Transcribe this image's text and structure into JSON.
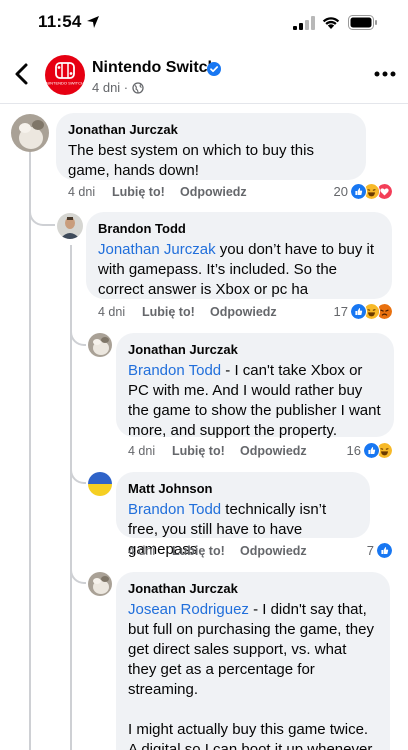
{
  "status_bar": {
    "time": "11:54"
  },
  "header": {
    "page_name": "Nintendo Switch",
    "time_ago": "4 dni ·",
    "logo_text": "NINTENDO SWITCH"
  },
  "comments": [
    {
      "author": "Jonathan Jurczak",
      "mention": "",
      "text": "The best system on which to buy this game, hands down!",
      "time": "4 dni",
      "like": "Lubię to!",
      "reply": "Odpowiedz",
      "reaction_count": "20",
      "reactions": [
        "like-icon",
        "haha-icon",
        "love-icon"
      ]
    },
    {
      "author": "Brandon Todd",
      "mention": "Jonathan Jurczak",
      "text": " you don’t have to buy it with gamepass. It’s included. So the correct answer is Xbox or pc ha",
      "time": "4 dni",
      "like": "Lubię to!",
      "reply": "Odpowiedz",
      "reaction_count": "17",
      "reactions": [
        "like-icon",
        "haha-icon",
        "angry-icon"
      ]
    },
    {
      "author": "Jonathan Jurczak",
      "mention": "Brandon Todd",
      "text": " - I can't take Xbox or PC with me. And I would rather buy the game to show the publisher I want more, and support the property.",
      "time": "4 dni",
      "like": "Lubię to!",
      "reply": "Odpowiedz",
      "reaction_count": "16",
      "reactions": [
        "like-icon",
        "haha-icon"
      ]
    },
    {
      "author": "Matt Johnson",
      "mention": "Brandon Todd",
      "text": " technically isn’t free, you still have to have gamepass",
      "time": "4 dni",
      "like": "Lubię to!",
      "reply": "Odpowiedz",
      "reaction_count": "7",
      "reactions": [
        "like-icon"
      ]
    },
    {
      "author": "Jonathan Jurczak",
      "mention": "Josean Rodriguez",
      "text": " - I didn't say that, but full on purchasing the game, they get direct sales support, vs. what they get as a percentage for streaming.",
      "text2": "I might actually buy this game twice. A digital so I can boot it up whenever, and a physical to collect. 😍"
    }
  ],
  "colors": {
    "mention": "#216fdb",
    "like_blue": "#1877f2",
    "verified": "#1877f2",
    "bubble": "#f0f2f5",
    "nintendo_red": "#e60012"
  }
}
